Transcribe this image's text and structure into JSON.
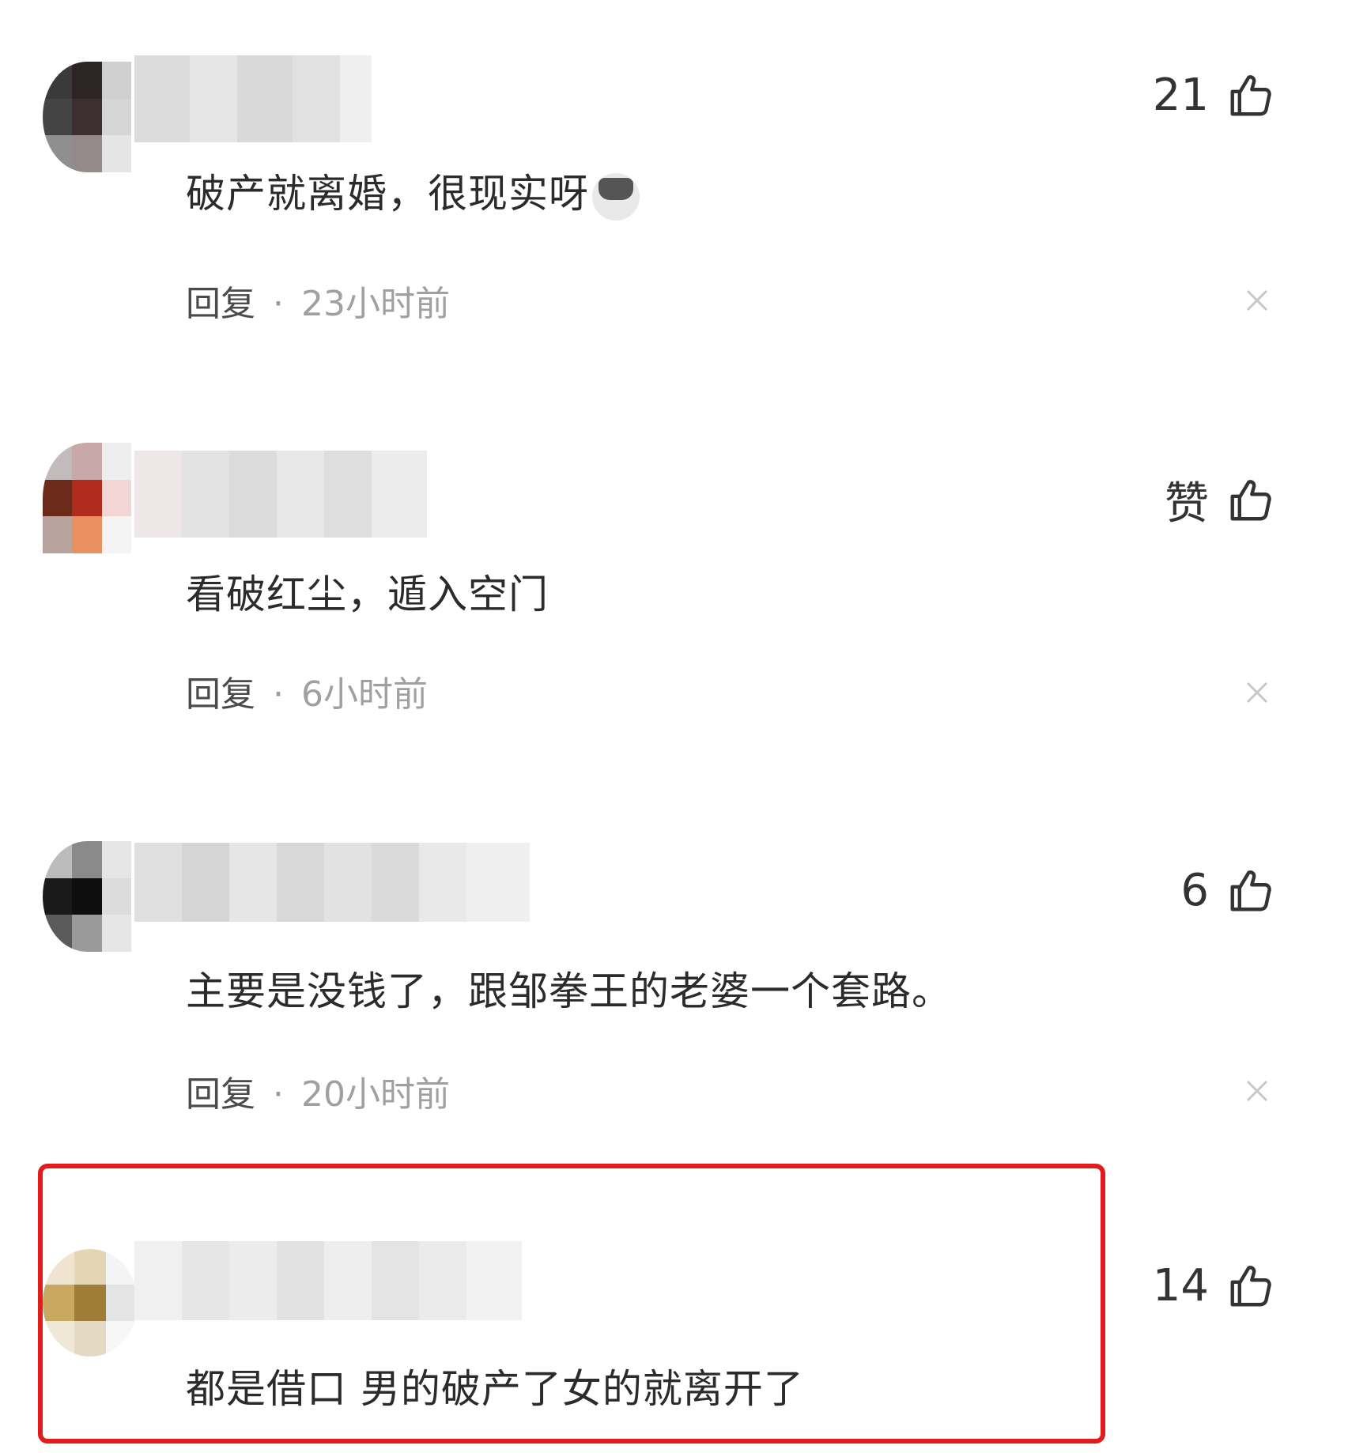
{
  "comments": [
    {
      "text": "破产就离婚，很现实呀",
      "emoji": "cat-emoji",
      "reply_label": "回复",
      "separator": "·",
      "time": "23小时前",
      "likes": "21",
      "avatar_colors": [
        "#3a3a3a",
        "#2d2424",
        "#cfcfcf",
        "#444444",
        "#3b2f2f",
        "#d5d5d5",
        "#8f8f8f",
        "#948a8a",
        "#e5e5e5"
      ],
      "highlighted": false
    },
    {
      "text": "看破红尘，遁入空门",
      "reply_label": "回复",
      "separator": "·",
      "time": "6小时前",
      "likes": "赞",
      "avatar_colors": [
        "#c4bcbc",
        "#c8a8a8",
        "#eeeeee",
        "#6b2a1a",
        "#b02a1e",
        "#f2d6d6",
        "#b8a39e",
        "#e89060",
        "#f4f4f4"
      ],
      "highlighted": false
    },
    {
      "text": "主要是没钱了，跟邹拳王的老婆一个套路。",
      "reply_label": "回复",
      "separator": "·",
      "time": "20小时前",
      "likes": "6",
      "avatar_colors": [
        "#bcbcbc",
        "#8a8a8a",
        "#e6e6e6",
        "#1a1a1a",
        "#0e0e0e",
        "#dcdcdc",
        "#5a5a5a",
        "#9a9a9a",
        "#e6e6e6"
      ],
      "highlighted": false
    },
    {
      "text": "都是借口 男的破产了女的就离开了",
      "likes": "14",
      "avatar_colors": [
        "#efe4cf",
        "#e4d6b5",
        "#f4f4f4",
        "#c9a860",
        "#9f7c38",
        "#e4e4e4",
        "#efe7d8",
        "#e4dac4",
        "#f7f7f7"
      ],
      "highlighted": true
    }
  ],
  "colors": {
    "highlight_border": "#e21b1b"
  }
}
